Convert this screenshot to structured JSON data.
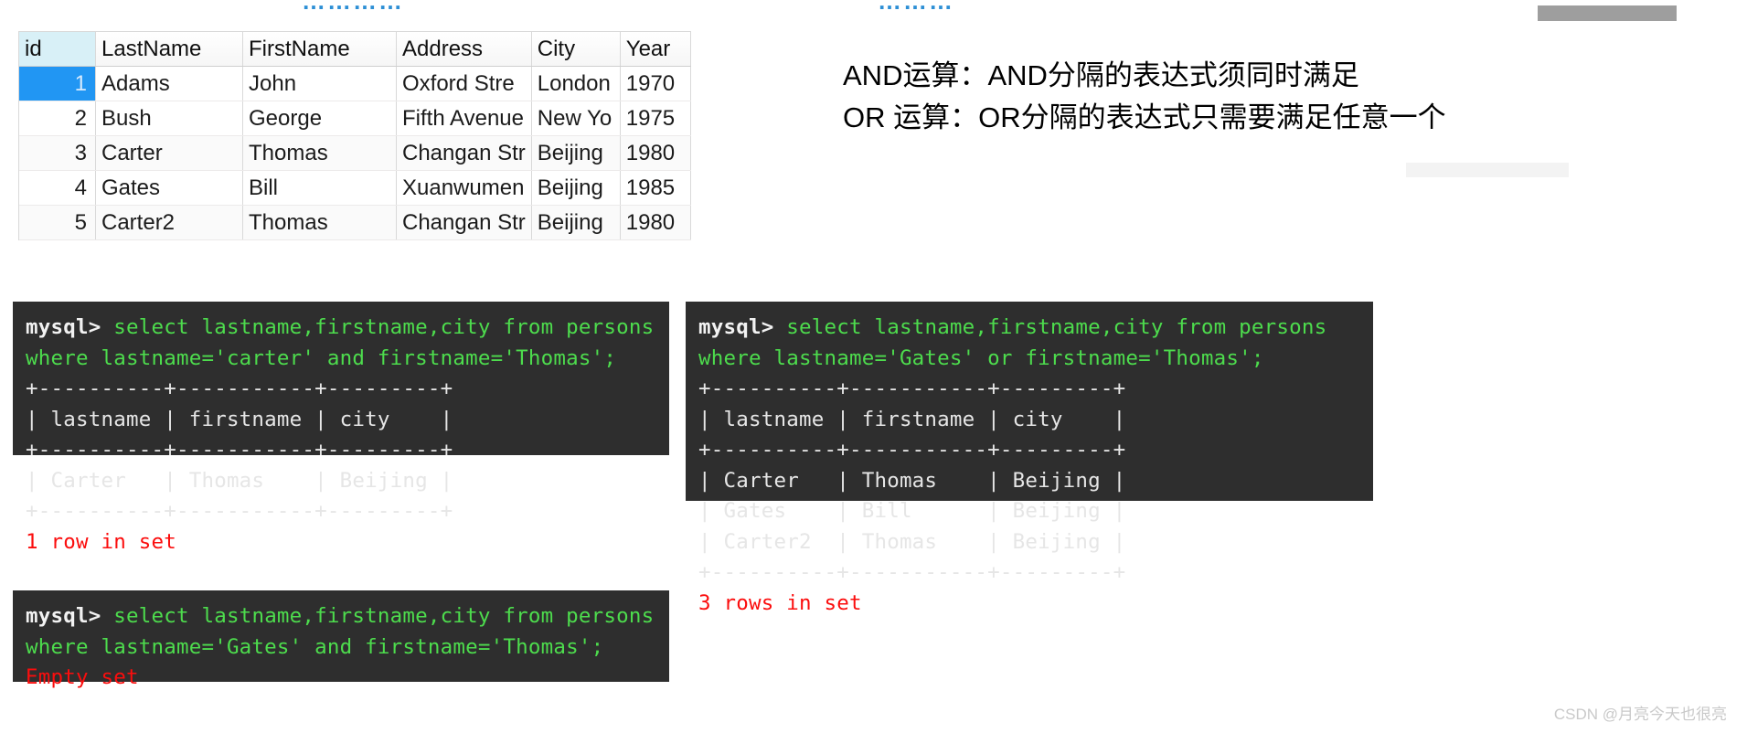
{
  "top_cut_text": {
    "left_fragment": "…………",
    "right_fragment": "………"
  },
  "persons_table": {
    "name": "persons",
    "columns": [
      "id",
      "LastName",
      "FirstName",
      "Address",
      "City",
      "Year"
    ],
    "rows": [
      {
        "id": "1",
        "LastName": "Adams",
        "FirstName": "John",
        "Address": "Oxford Stre",
        "City": "London",
        "Year": "1970",
        "selected": true
      },
      {
        "id": "2",
        "LastName": "Bush",
        "FirstName": "George",
        "Address": "Fifth Avenue",
        "City": "New Yo",
        "Year": "1975",
        "selected": false
      },
      {
        "id": "3",
        "LastName": "Carter",
        "FirstName": "Thomas",
        "Address": "Changan Str",
        "City": "Beijing",
        "Year": "1980",
        "selected": false
      },
      {
        "id": "4",
        "LastName": "Gates",
        "FirstName": "Bill",
        "Address": "Xuanwumen",
        "City": "Beijing",
        "Year": "1985",
        "selected": false
      },
      {
        "id": "5",
        "LastName": "Carter2",
        "FirstName": "Thomas",
        "Address": "Changan Str",
        "City": "Beijing",
        "Year": "1980",
        "selected": false
      }
    ]
  },
  "notes": {
    "line1": "AND运算：AND分隔的表达式须同时满足",
    "line2": "OR 运算：OR分隔的表达式只需要满足任意一个"
  },
  "terminals": {
    "and_match": {
      "prompt": "mysql> ",
      "query_line1": "select lastname,firstname,city from persons",
      "query_line2": "where lastname='carter' and firstname='Thomas';",
      "separator": "+----------+-----------+---------+",
      "header_row": "| lastname | firstname | city    |",
      "data_rows": [
        "| Carter   | Thomas    | Beijing |"
      ],
      "status": "1 row in set"
    },
    "and_empty": {
      "prompt": "mysql> ",
      "query_line1": "select lastname,firstname,city from persons",
      "query_line2": "where lastname='Gates' and firstname='Thomas';",
      "status": "Empty set"
    },
    "or_match": {
      "prompt": "mysql> ",
      "query_line1": "select lastname,firstname,city from persons",
      "query_line2": "where lastname='Gates' or firstname='Thomas';",
      "separator": "+----------+-----------+---------+",
      "header_row": "| lastname | firstname | city    |",
      "data_rows": [
        "| Carter   | Thomas    | Beijing |",
        "| Gates    | Bill      | Beijing |",
        "| Carter2  | Thomas    | Beijing |"
      ],
      "status": "3 rows in set"
    }
  },
  "watermark": "CSDN @月亮今天也很亮",
  "colors": {
    "terminal_background": "#2e2e2e",
    "sql_green": "#4ddc4d",
    "status_red": "#fb0d0d",
    "selection_blue": "#2196f3",
    "id_header_blue": "#d8f0f7"
  }
}
